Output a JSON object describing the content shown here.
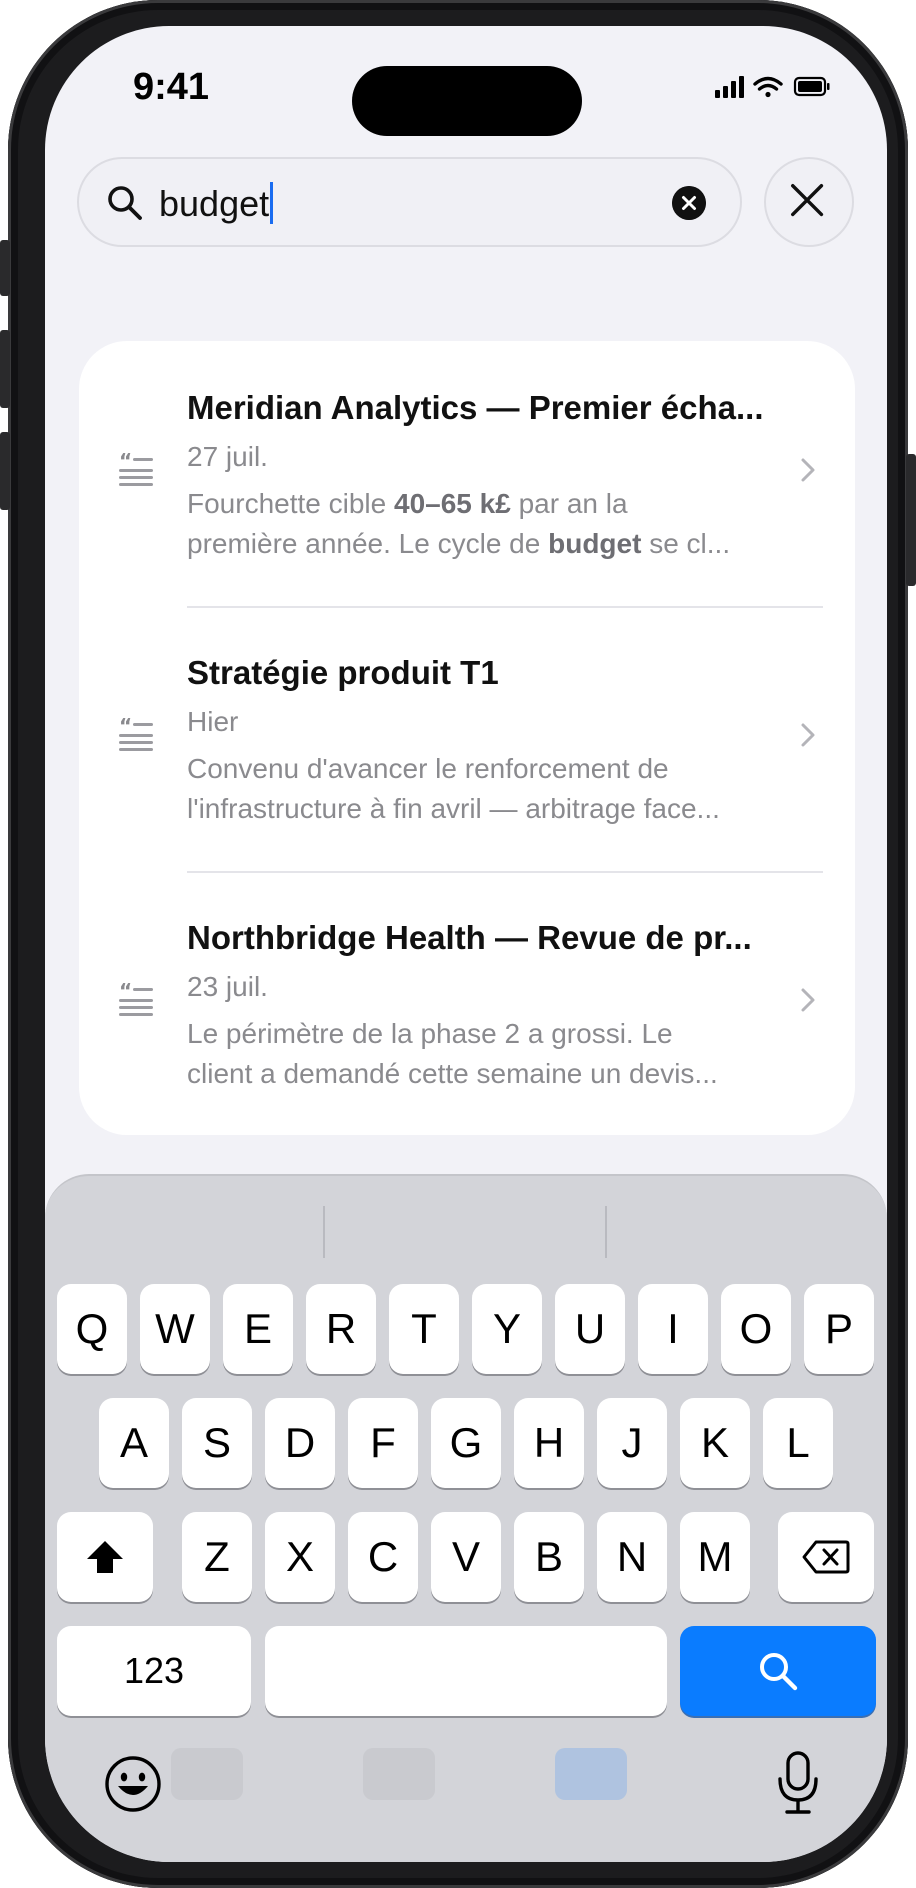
{
  "status": {
    "time": "9:41"
  },
  "search": {
    "query": "budget"
  },
  "results": [
    {
      "title": "Meridian Analytics — Premier écha...",
      "date": "27 juil.",
      "snippet_line1": [
        "Fourchette cible ",
        "40–65 k£",
        " par an la"
      ],
      "snippet_line2": [
        "première année. Le cycle de ",
        "budget",
        " se cl..."
      ]
    },
    {
      "title": "Stratégie produit T1",
      "date": "Hier",
      "snippet_line1": [
        "Convenu d'avancer le renforcement de",
        "",
        ""
      ],
      "snippet_line2": [
        "l'infrastructure à fin avril — arbitrage face...",
        "",
        ""
      ]
    },
    {
      "title": "Northbridge Health — Revue de pr...",
      "date": "23 juil.",
      "snippet_line1": [
        "Le périmètre de la phase 2 a grossi. Le",
        "",
        ""
      ],
      "snippet_line2": [
        "client a demandé cette semaine un devis...",
        "",
        ""
      ]
    }
  ],
  "keyboard": {
    "row1": [
      "Q",
      "W",
      "E",
      "R",
      "T",
      "Y",
      "U",
      "I",
      "O",
      "P"
    ],
    "row2": [
      "A",
      "S",
      "D",
      "F",
      "G",
      "H",
      "J",
      "K",
      "L"
    ],
    "row3": [
      "Z",
      "X",
      "C",
      "V",
      "B",
      "N",
      "M"
    ],
    "numbers_label": "123"
  },
  "colors": {
    "accent": "#0a7cff",
    "background": "#f2f2f7",
    "keyboard": "#d3d4d9"
  },
  "icons": [
    "search-icon",
    "clear-icon",
    "close-icon",
    "quote-icon",
    "chevron-right-icon",
    "shift-icon",
    "backspace-icon",
    "emoji-icon",
    "microphone-icon"
  ]
}
